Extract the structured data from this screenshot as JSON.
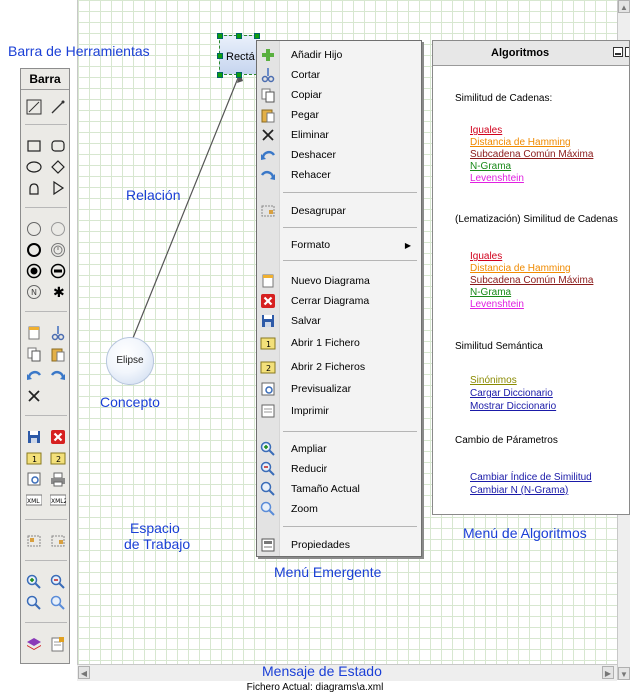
{
  "colors": {
    "annotation": "#1a3fd6",
    "red": "#d1001c",
    "orange": "#f08a00",
    "darkred": "#8a1a1a",
    "green": "#1a8a1a",
    "magenta": "#e020e0",
    "navy": "#1a1aa8",
    "olive": "#8a8a00"
  },
  "annotations": {
    "toolbar": "Barra de Herramientas",
    "relation": "Relación",
    "concept": "Concepto",
    "workspace_line1": "Espacio",
    "workspace_line2": "de Trabajo",
    "popup_menu": "Menú Emergente",
    "algorithms_menu": "Menú de Algoritmos",
    "status_message": "Mensaje de Estado"
  },
  "toolbar": {
    "title": "Barra"
  },
  "diagram": {
    "rect_label": "Rectá",
    "ellipse_label": "Elipse"
  },
  "context_menu": {
    "items": [
      {
        "label": "Añadir Hijo",
        "icon": "add-child-icon"
      },
      {
        "label": "Cortar",
        "icon": "cut-icon"
      },
      {
        "label": "Copiar",
        "icon": "copy-icon"
      },
      {
        "label": "Pegar",
        "icon": "paste-icon"
      },
      {
        "label": "Eliminar",
        "icon": "delete-icon"
      },
      {
        "label": "Deshacer",
        "icon": "undo-icon"
      },
      {
        "label": "Rehacer",
        "icon": "redo-icon"
      },
      {
        "label": "Desagrupar",
        "icon": "ungroup-icon"
      },
      {
        "label": "Formato",
        "icon": "",
        "submenu": true
      },
      {
        "label": "Nuevo Diagrama",
        "icon": "new-diagram-icon"
      },
      {
        "label": "Cerrar Diagrama",
        "icon": "close-diagram-icon"
      },
      {
        "label": "Salvar",
        "icon": "save-icon"
      },
      {
        "label": "Abrir 1 Fichero",
        "icon": "open-1-icon"
      },
      {
        "label": "Abrir 2 Ficheros",
        "icon": "open-2-icon"
      },
      {
        "label": "Previsualizar",
        "icon": "preview-icon"
      },
      {
        "label": "Imprimir",
        "icon": "print-icon"
      },
      {
        "label": "Ampliar",
        "icon": "zoom-in-icon"
      },
      {
        "label": "Reducir",
        "icon": "zoom-out-icon"
      },
      {
        "label": "Tamaño Actual",
        "icon": "actual-size-icon"
      },
      {
        "label": "Zoom",
        "icon": "zoom-icon"
      },
      {
        "label": "Propiedades",
        "icon": "properties-icon"
      }
    ]
  },
  "algorithms": {
    "title": "Algoritmos",
    "sections": [
      {
        "heading": "Similitud de Cadenas:",
        "links": [
          {
            "label": "Iguales",
            "color": "#d1001c"
          },
          {
            "label": "Distancia de Hamming",
            "color": "#f08a00"
          },
          {
            "label": "Subcadena Común Máxima",
            "color": "#8a1a1a"
          },
          {
            "label": "N-Grama",
            "color": "#1a8a1a"
          },
          {
            "label": "Levenshtein",
            "color": "#e020e0"
          }
        ]
      },
      {
        "heading": "(Lematización) Similitud de Cadenas",
        "links": [
          {
            "label": "Iguales",
            "color": "#d1001c"
          },
          {
            "label": "Distancia de Hamming",
            "color": "#f08a00"
          },
          {
            "label": "Subcadena Común Máxima",
            "color": "#8a1a1a"
          },
          {
            "label": "N-Grama",
            "color": "#1a8a1a"
          },
          {
            "label": "Levenshtein",
            "color": "#e020e0"
          }
        ]
      },
      {
        "heading": "Similitud Semántica",
        "links": [
          {
            "label": "Sinónimos",
            "color": "#8a8a00"
          },
          {
            "label": "Cargar Diccionario",
            "color": "#1a1aa8"
          },
          {
            "label": "Mostrar Diccionario",
            "color": "#1a1aa8"
          }
        ]
      },
      {
        "heading": "Cambio de Párametros",
        "links": [
          {
            "label": "Cambiar Índice de Similitud",
            "color": "#1a1aa8"
          },
          {
            "label": "Cambiar N (N-Grama)",
            "color": "#1a1aa8"
          }
        ]
      }
    ]
  },
  "status": {
    "text": "Fichero Actual: diagrams\\a.xml"
  }
}
